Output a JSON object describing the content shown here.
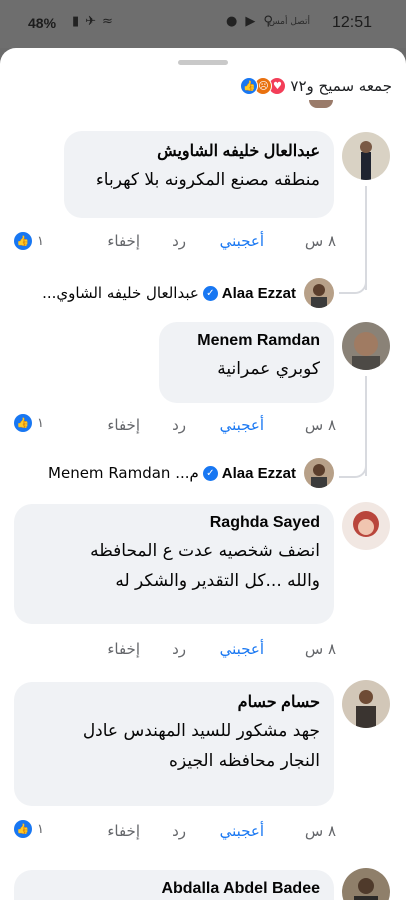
{
  "status_bar": {
    "time": "12:51",
    "carrier": "أتصل أمس",
    "battery": "48%"
  },
  "header": {
    "reactions_summary": "جمعه سميح و٧٢",
    "reaction_icons": [
      "like-icon",
      "angry-icon",
      "love-icon"
    ]
  },
  "comments": [
    {
      "author": "عبدالعال خليفه الشاويش",
      "text": "منطقه مصنع المكرونه بلا كهرباء",
      "time": "٨ س",
      "like": "أعجبني",
      "reply": "رد",
      "hide": "إخفاء",
      "likes_count": "١",
      "reply_preview": {
        "author": "Alaa Ezzat",
        "text": "عبدالعال خليفه الشاوي..."
      }
    },
    {
      "author": "Menem Ramdan",
      "text": "كوبري عمرانية",
      "time": "٨ س",
      "like": "أعجبني",
      "reply": "رد",
      "hide": "إخفاء",
      "likes_count": "١",
      "reply_preview": {
        "author": "Alaa Ezzat",
        "text": "م...   Menem Ramdan"
      }
    },
    {
      "author": "Raghda Sayed",
      "text_line1": "انضف شخصيه عدت ع المحافظه",
      "text_line2": "والله ...كل التقدير والشكر له",
      "time": "٨ س",
      "like": "أعجبني",
      "reply": "رد",
      "hide": "إخفاء"
    },
    {
      "author": "حسام حسام",
      "text_line1": "جهد مشكور للسيد المهندس عادل",
      "text_line2": "النجار محافظه الجيزه",
      "time": "٨ س",
      "like": "أعجبني",
      "reply": "رد",
      "hide": "إخفاء",
      "likes_count": "١"
    },
    {
      "author": "Abdalla Abdel Badee"
    }
  ],
  "colors": {
    "accent": "#1877f2",
    "bubble": "#f0f2f5",
    "muted": "#65676b"
  }
}
